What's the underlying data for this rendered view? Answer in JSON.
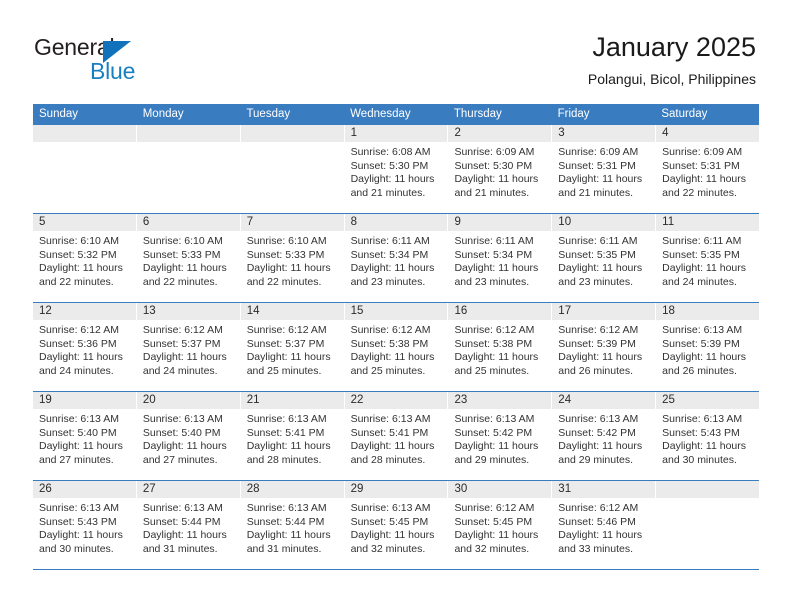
{
  "brand": {
    "name_part1": "General",
    "name_part2": "Blue",
    "accent_color": "#1a7fc1"
  },
  "header": {
    "title": "January 2025",
    "subtitle": "Polangui, Bicol, Philippines"
  },
  "calendar": {
    "header_bg": "#3a7cc0",
    "weekdays": [
      "Sunday",
      "Monday",
      "Tuesday",
      "Wednesday",
      "Thursday",
      "Friday",
      "Saturday"
    ],
    "weeks": [
      [
        {
          "day": "",
          "sunrise": "",
          "sunset": "",
          "daylight_line1": "",
          "daylight_line2": ""
        },
        {
          "day": "",
          "sunrise": "",
          "sunset": "",
          "daylight_line1": "",
          "daylight_line2": ""
        },
        {
          "day": "",
          "sunrise": "",
          "sunset": "",
          "daylight_line1": "",
          "daylight_line2": ""
        },
        {
          "day": "1",
          "sunrise": "Sunrise: 6:08 AM",
          "sunset": "Sunset: 5:30 PM",
          "daylight_line1": "Daylight: 11 hours",
          "daylight_line2": "and 21 minutes."
        },
        {
          "day": "2",
          "sunrise": "Sunrise: 6:09 AM",
          "sunset": "Sunset: 5:30 PM",
          "daylight_line1": "Daylight: 11 hours",
          "daylight_line2": "and 21 minutes."
        },
        {
          "day": "3",
          "sunrise": "Sunrise: 6:09 AM",
          "sunset": "Sunset: 5:31 PM",
          "daylight_line1": "Daylight: 11 hours",
          "daylight_line2": "and 21 minutes."
        },
        {
          "day": "4",
          "sunrise": "Sunrise: 6:09 AM",
          "sunset": "Sunset: 5:31 PM",
          "daylight_line1": "Daylight: 11 hours",
          "daylight_line2": "and 22 minutes."
        }
      ],
      [
        {
          "day": "5",
          "sunrise": "Sunrise: 6:10 AM",
          "sunset": "Sunset: 5:32 PM",
          "daylight_line1": "Daylight: 11 hours",
          "daylight_line2": "and 22 minutes."
        },
        {
          "day": "6",
          "sunrise": "Sunrise: 6:10 AM",
          "sunset": "Sunset: 5:33 PM",
          "daylight_line1": "Daylight: 11 hours",
          "daylight_line2": "and 22 minutes."
        },
        {
          "day": "7",
          "sunrise": "Sunrise: 6:10 AM",
          "sunset": "Sunset: 5:33 PM",
          "daylight_line1": "Daylight: 11 hours",
          "daylight_line2": "and 22 minutes."
        },
        {
          "day": "8",
          "sunrise": "Sunrise: 6:11 AM",
          "sunset": "Sunset: 5:34 PM",
          "daylight_line1": "Daylight: 11 hours",
          "daylight_line2": "and 23 minutes."
        },
        {
          "day": "9",
          "sunrise": "Sunrise: 6:11 AM",
          "sunset": "Sunset: 5:34 PM",
          "daylight_line1": "Daylight: 11 hours",
          "daylight_line2": "and 23 minutes."
        },
        {
          "day": "10",
          "sunrise": "Sunrise: 6:11 AM",
          "sunset": "Sunset: 5:35 PM",
          "daylight_line1": "Daylight: 11 hours",
          "daylight_line2": "and 23 minutes."
        },
        {
          "day": "11",
          "sunrise": "Sunrise: 6:11 AM",
          "sunset": "Sunset: 5:35 PM",
          "daylight_line1": "Daylight: 11 hours",
          "daylight_line2": "and 24 minutes."
        }
      ],
      [
        {
          "day": "12",
          "sunrise": "Sunrise: 6:12 AM",
          "sunset": "Sunset: 5:36 PM",
          "daylight_line1": "Daylight: 11 hours",
          "daylight_line2": "and 24 minutes."
        },
        {
          "day": "13",
          "sunrise": "Sunrise: 6:12 AM",
          "sunset": "Sunset: 5:37 PM",
          "daylight_line1": "Daylight: 11 hours",
          "daylight_line2": "and 24 minutes."
        },
        {
          "day": "14",
          "sunrise": "Sunrise: 6:12 AM",
          "sunset": "Sunset: 5:37 PM",
          "daylight_line1": "Daylight: 11 hours",
          "daylight_line2": "and 25 minutes."
        },
        {
          "day": "15",
          "sunrise": "Sunrise: 6:12 AM",
          "sunset": "Sunset: 5:38 PM",
          "daylight_line1": "Daylight: 11 hours",
          "daylight_line2": "and 25 minutes."
        },
        {
          "day": "16",
          "sunrise": "Sunrise: 6:12 AM",
          "sunset": "Sunset: 5:38 PM",
          "daylight_line1": "Daylight: 11 hours",
          "daylight_line2": "and 25 minutes."
        },
        {
          "day": "17",
          "sunrise": "Sunrise: 6:12 AM",
          "sunset": "Sunset: 5:39 PM",
          "daylight_line1": "Daylight: 11 hours",
          "daylight_line2": "and 26 minutes."
        },
        {
          "day": "18",
          "sunrise": "Sunrise: 6:13 AM",
          "sunset": "Sunset: 5:39 PM",
          "daylight_line1": "Daylight: 11 hours",
          "daylight_line2": "and 26 minutes."
        }
      ],
      [
        {
          "day": "19",
          "sunrise": "Sunrise: 6:13 AM",
          "sunset": "Sunset: 5:40 PM",
          "daylight_line1": "Daylight: 11 hours",
          "daylight_line2": "and 27 minutes."
        },
        {
          "day": "20",
          "sunrise": "Sunrise: 6:13 AM",
          "sunset": "Sunset: 5:40 PM",
          "daylight_line1": "Daylight: 11 hours",
          "daylight_line2": "and 27 minutes."
        },
        {
          "day": "21",
          "sunrise": "Sunrise: 6:13 AM",
          "sunset": "Sunset: 5:41 PM",
          "daylight_line1": "Daylight: 11 hours",
          "daylight_line2": "and 28 minutes."
        },
        {
          "day": "22",
          "sunrise": "Sunrise: 6:13 AM",
          "sunset": "Sunset: 5:41 PM",
          "daylight_line1": "Daylight: 11 hours",
          "daylight_line2": "and 28 minutes."
        },
        {
          "day": "23",
          "sunrise": "Sunrise: 6:13 AM",
          "sunset": "Sunset: 5:42 PM",
          "daylight_line1": "Daylight: 11 hours",
          "daylight_line2": "and 29 minutes."
        },
        {
          "day": "24",
          "sunrise": "Sunrise: 6:13 AM",
          "sunset": "Sunset: 5:42 PM",
          "daylight_line1": "Daylight: 11 hours",
          "daylight_line2": "and 29 minutes."
        },
        {
          "day": "25",
          "sunrise": "Sunrise: 6:13 AM",
          "sunset": "Sunset: 5:43 PM",
          "daylight_line1": "Daylight: 11 hours",
          "daylight_line2": "and 30 minutes."
        }
      ],
      [
        {
          "day": "26",
          "sunrise": "Sunrise: 6:13 AM",
          "sunset": "Sunset: 5:43 PM",
          "daylight_line1": "Daylight: 11 hours",
          "daylight_line2": "and 30 minutes."
        },
        {
          "day": "27",
          "sunrise": "Sunrise: 6:13 AM",
          "sunset": "Sunset: 5:44 PM",
          "daylight_line1": "Daylight: 11 hours",
          "daylight_line2": "and 31 minutes."
        },
        {
          "day": "28",
          "sunrise": "Sunrise: 6:13 AM",
          "sunset": "Sunset: 5:44 PM",
          "daylight_line1": "Daylight: 11 hours",
          "daylight_line2": "and 31 minutes."
        },
        {
          "day": "29",
          "sunrise": "Sunrise: 6:13 AM",
          "sunset": "Sunset: 5:45 PM",
          "daylight_line1": "Daylight: 11 hours",
          "daylight_line2": "and 32 minutes."
        },
        {
          "day": "30",
          "sunrise": "Sunrise: 6:12 AM",
          "sunset": "Sunset: 5:45 PM",
          "daylight_line1": "Daylight: 11 hours",
          "daylight_line2": "and 32 minutes."
        },
        {
          "day": "31",
          "sunrise": "Sunrise: 6:12 AM",
          "sunset": "Sunset: 5:46 PM",
          "daylight_line1": "Daylight: 11 hours",
          "daylight_line2": "and 33 minutes."
        },
        {
          "day": "",
          "sunrise": "",
          "sunset": "",
          "daylight_line1": "",
          "daylight_line2": ""
        }
      ]
    ]
  }
}
